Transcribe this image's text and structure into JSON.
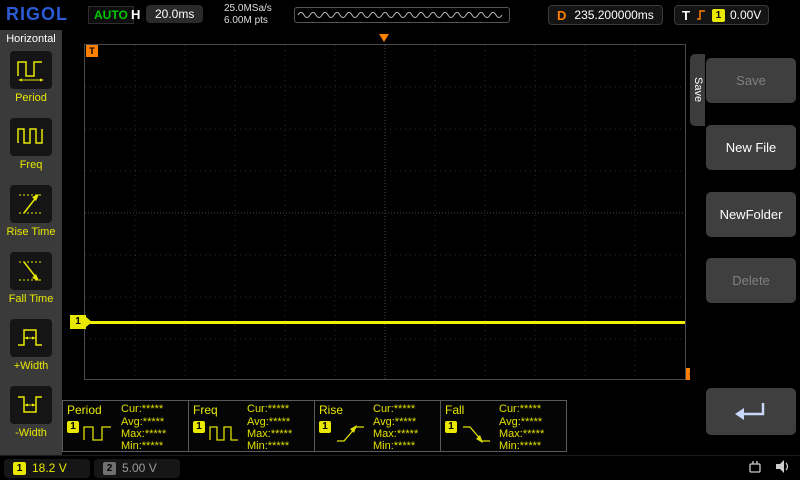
{
  "topbar": {
    "logo": "RIGOL",
    "run_state": "AUTO",
    "h_label": "H",
    "timebase": "20.0ms",
    "sample_rate": "25.0MSa/s",
    "memory_depth": "6.00M pts",
    "d_label": "D",
    "delay": "235.200000ms",
    "t_label": "T",
    "trigger_channel": "1",
    "trigger_level": "0.00V"
  },
  "left_menu": {
    "title": "Horizontal",
    "items": [
      {
        "label": "Period"
      },
      {
        "label": "Freq"
      },
      {
        "label": "Rise Time"
      },
      {
        "label": "Fall Time"
      },
      {
        "label": "+Width"
      },
      {
        "label": "-Width"
      }
    ]
  },
  "grid": {
    "trigger_marker": "T",
    "channel_marker": "1"
  },
  "right_menu": {
    "tab": "Save",
    "buttons": [
      {
        "label": "Save",
        "enabled": false
      },
      {
        "label": "New File",
        "enabled": true
      },
      {
        "label": "NewFolder",
        "enabled": true
      },
      {
        "label": "Delete",
        "enabled": false
      }
    ]
  },
  "measurements": [
    {
      "label": "Period",
      "channel": "1",
      "cur": "Cur:*****",
      "avg": "Avg:*****",
      "max": "Max:*****",
      "min": "Min:*****"
    },
    {
      "label": "Freq",
      "channel": "1",
      "cur": "Cur:*****",
      "avg": "Avg:*****",
      "max": "Max:*****",
      "min": "Min:*****"
    },
    {
      "label": "Rise",
      "channel": "1",
      "cur": "Cur:*****",
      "avg": "Avg:*****",
      "max": "Max:*****",
      "min": "Min:*****"
    },
    {
      "label": "Fall",
      "channel": "1",
      "cur": "Cur:*****",
      "avg": "Avg:*****",
      "max": "Max:*****",
      "min": "Min:*****"
    }
  ],
  "status_bar": {
    "ch1_number": "1",
    "ch1_scale": "18.2 V",
    "ch2_number": "2",
    "ch2_scale": "5.00 V"
  },
  "colors": {
    "channel1_yellow": "#e8e800",
    "channel2_gray": "#9a9a9a",
    "trigger_orange": "#ff8000",
    "run_green": "#00c800",
    "logo_blue": "#2b5bd7"
  }
}
